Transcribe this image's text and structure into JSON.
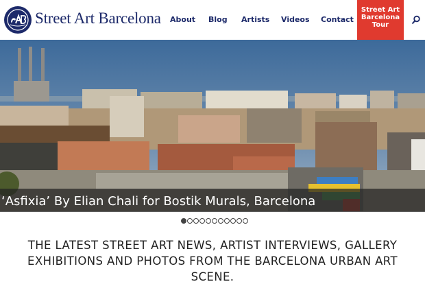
{
  "site": {
    "title": "Street Art Barcelona",
    "logo_icon": "sab-logo-icon"
  },
  "nav": {
    "items": [
      {
        "label": "About"
      },
      {
        "label": "Blog"
      },
      {
        "label": "Artists"
      },
      {
        "label": "Videos"
      },
      {
        "label": "Contact"
      }
    ],
    "tour": {
      "line1": "Street Art",
      "line2": "Barcelona",
      "line3": "Tour"
    },
    "search_icon": "search-icon"
  },
  "hero": {
    "caption": "‘Asfixia’ By Elian Chali for Bostik Murals, Barcelona"
  },
  "slider": {
    "total": 11,
    "active_index": 0
  },
  "tagline": "THE LATEST STREET ART NEWS, ARTIST INTERVIEWS, GALLERY EXHIBITIONS AND PHOTOS FROM THE BARCELONA URBAN ART SCENE.",
  "colors": {
    "brand_navy": "#1d2a6a",
    "tour_red": "#e03a2f",
    "text": "#222222"
  }
}
